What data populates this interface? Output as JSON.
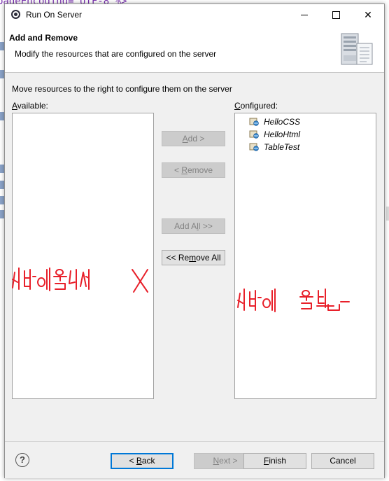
{
  "background": {
    "code_fragment": "pageEncoding=\"UTF-8\"%>"
  },
  "window": {
    "title": "Run On Server",
    "minimize_icon": "minimize-icon",
    "maximize_icon": "maximize-icon",
    "close_glyph": "✕"
  },
  "header": {
    "title": "Add and Remove",
    "description": "Modify the resources that are configured on the server"
  },
  "instructions": "Move resources to the right to configure them on the server",
  "available": {
    "label_mnemonic": "A",
    "label_rest": "vailable:",
    "items": []
  },
  "configured": {
    "label_mnemonic": "C",
    "label_rest": "onfigured:",
    "items": [
      {
        "label": "HelloCSS",
        "icon": "web-module-icon"
      },
      {
        "label": "HelloHtml",
        "icon": "web-module-icon"
      },
      {
        "label": "TableTest",
        "icon": "web-module-icon"
      }
    ]
  },
  "buttons": {
    "add": {
      "pre": "",
      "mnemonic": "A",
      "post": "dd >"
    },
    "remove": {
      "pre": "< ",
      "mnemonic": "R",
      "post": "emove"
    },
    "add_all": {
      "pre": "Add A",
      "mnemonic": "l",
      "post": "l >>"
    },
    "remove_all": {
      "pre": "<< Re",
      "mnemonic": "m",
      "post": "ove All"
    }
  },
  "annotations": {
    "left": "서버에 올리지 X",
    "right": "서버에 올림",
    "color": "#e8202a"
  },
  "footer": {
    "help_glyph": "?",
    "back": {
      "pre": "< ",
      "mnemonic": "B",
      "post": "ack"
    },
    "next": {
      "mnemonic": "N",
      "post": "ext >"
    },
    "finish": {
      "mnemonic": "F",
      "post": "inish"
    },
    "cancel": "Cancel"
  }
}
